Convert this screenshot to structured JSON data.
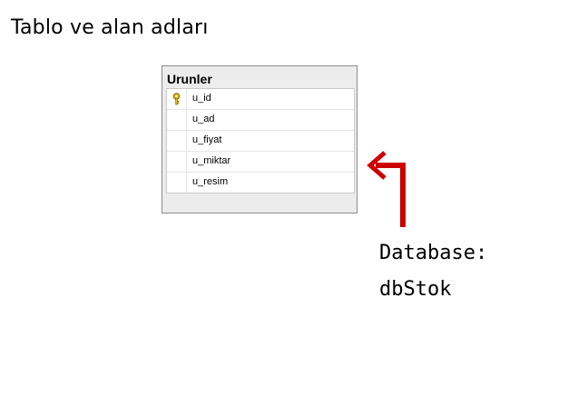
{
  "heading": "Tablo ve alan adları",
  "table": {
    "name": "Urunler",
    "columns": [
      {
        "name": "u_id",
        "icon": "key-icon"
      },
      {
        "name": "u_ad"
      },
      {
        "name": "u_fiyat"
      },
      {
        "name": "u_miktar"
      },
      {
        "name": "u_resim"
      }
    ]
  },
  "annotation": {
    "line1": "Database:",
    "line2": "dbStok",
    "arrow_color": "#cc0000"
  }
}
